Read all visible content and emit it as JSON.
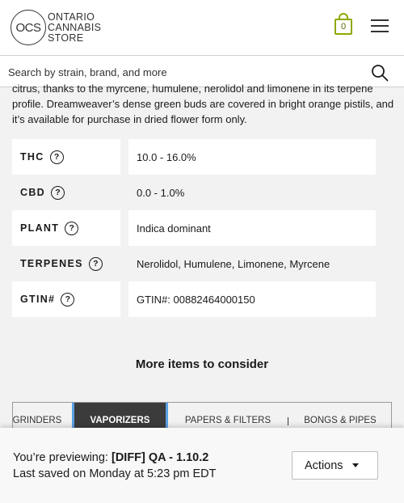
{
  "header": {
    "logo_mark": "OCS",
    "logo_lines": [
      "ONTARIO",
      "CANNABIS",
      "STORE"
    ],
    "cart_count": "0",
    "icons": {
      "cart": "shopping-bag-icon",
      "menu": "hamburger-menu-icon",
      "search": "search-icon"
    },
    "accent_color": "#8fa800"
  },
  "search": {
    "placeholder": "Search by strain, brand, and more"
  },
  "product": {
    "description": "citrus, thanks to the myrcene, humulene, nerolidol and limonene in its terpene profile. Dreamweaver’s dense green buds are covered in bright orange pistils, and it’s available for purchase in dried flower form only.",
    "attributes": [
      {
        "label": "THC",
        "help": "?",
        "value": "10.0 - 16.0%"
      },
      {
        "label": "CBD",
        "help": "?",
        "value": "0.0 - 1.0%"
      },
      {
        "label": "PLANT",
        "help": "?",
        "value": "Indica dominant"
      },
      {
        "label": "TERPENES",
        "help": "?",
        "value": "Nerolidol, Humulene, Limonene, Myrcene"
      },
      {
        "label": "GTIN#",
        "help": "?",
        "value": "GTIN#: 00882464000150"
      }
    ]
  },
  "more_items": {
    "title": "More items to consider",
    "tabs": [
      {
        "label": "GRINDERS",
        "active": false
      },
      {
        "label": "VAPORIZERS",
        "active": true
      },
      {
        "label": "PAPERS & FILTERS",
        "active": false
      },
      {
        "label": "BONGS & PIPES",
        "active": false
      }
    ]
  },
  "preview_bar": {
    "previewing_prefix": "You’re previewing: ",
    "previewing_name": "[DIFF] QA - 1.10.2",
    "last_saved": "Last saved on Monday at 5:23 pm EDT",
    "actions_label": "Actions"
  }
}
